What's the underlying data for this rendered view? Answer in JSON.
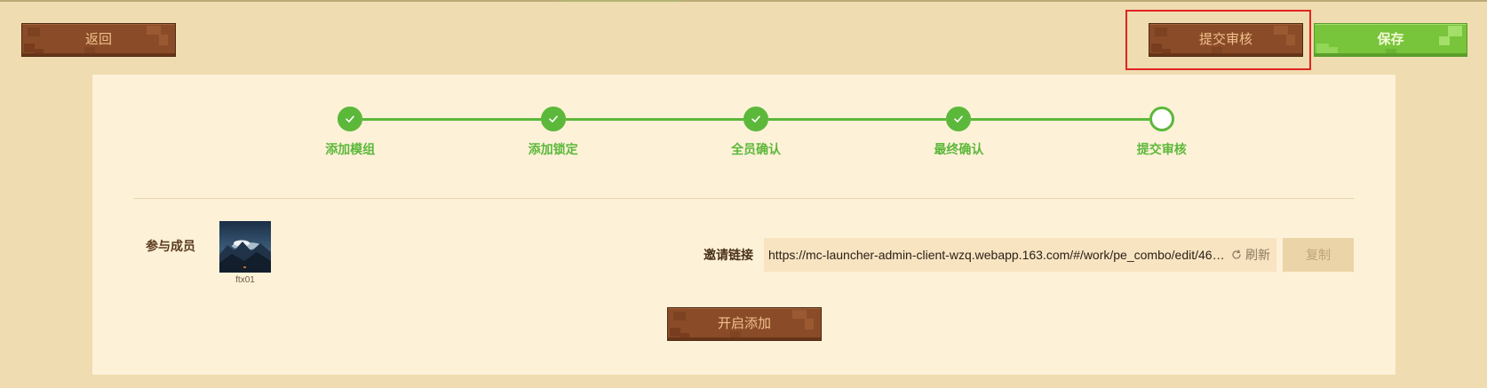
{
  "header": {
    "back_label": "返回",
    "submit_label": "提交审核",
    "save_label": "保存"
  },
  "steps": [
    {
      "label": "添加模组",
      "status": "done"
    },
    {
      "label": "添加锁定",
      "status": "done"
    },
    {
      "label": "全员确认",
      "status": "done"
    },
    {
      "label": "最终确认",
      "status": "done"
    },
    {
      "label": "提交审核",
      "status": "current"
    }
  ],
  "members": {
    "label": "参与成员",
    "list": [
      {
        "name": "ftx01",
        "avatar_icon": "mountain-landscape-avatar"
      }
    ]
  },
  "invite": {
    "label": "邀请链接",
    "url": "https://mc-launcher-admin-client-wzq.webapp.163.com/#/work/pe_combo/edit/46…",
    "refresh_label": "刷新",
    "copy_label": "复制"
  },
  "enable_add_label": "开启添加",
  "icons": {
    "step_done": "check-icon",
    "refresh": "refresh-icon"
  },
  "colors": {
    "page_bg": "#efdcb0",
    "panel_bg": "#fdf1d8",
    "accent_green": "#5cb83a",
    "brown_button": "#8a4c28",
    "save_green": "#78c43b",
    "highlight_red": "#e02424"
  }
}
